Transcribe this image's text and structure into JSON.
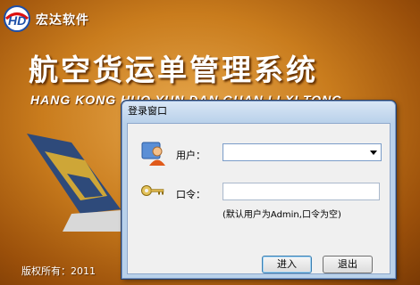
{
  "splash": {
    "company_name": "宏达软件",
    "main_title": "航空货运单管理系统",
    "pinyin_subtitle": "HANG KONG HUO YUN DAN GUAN LI XI TONG",
    "copyright": "版权所有：2011"
  },
  "dialog": {
    "title": "登录窗口",
    "user_label": "用户：",
    "user_value": "",
    "password_label": "口令：",
    "password_value": "",
    "hint": "(默认用户为Admin,口令为空)",
    "login_button": "进入",
    "exit_button": "退出"
  },
  "colors": {
    "background": "#c97c1d",
    "dialog_frame": "#b9d1ea",
    "dialog_body": "#f0f0f0"
  },
  "icons": {
    "logo": "hd-logo-icon",
    "plane": "airplane-tail-icon",
    "user": "user-icon",
    "key": "key-icon",
    "dropdown": "chevron-down-icon"
  }
}
